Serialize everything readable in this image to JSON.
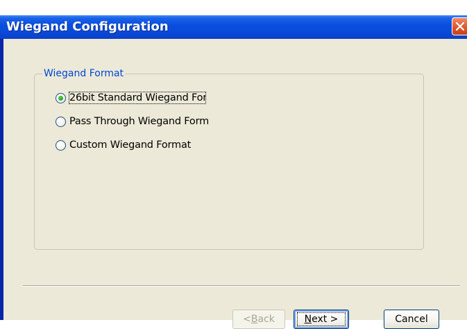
{
  "window": {
    "title": "Wiegand Configuration",
    "close_icon": "close-x-icon",
    "titlebar_color": "#0a4ad9",
    "close_color": "#e35a2f"
  },
  "group": {
    "label": "Wiegand Format",
    "label_color": "#0046d5",
    "options": [
      {
        "label": "26bit Standard Wiegand For",
        "checked": true,
        "focused": true
      },
      {
        "label": "Pass Through Wiegand Forma",
        "checked": false
      },
      {
        "label": "Custom Wiegand Format",
        "checked": false
      }
    ]
  },
  "buttons": {
    "back": {
      "prefix": "< ",
      "mnemonic": "B",
      "rest": "ack",
      "enabled": false
    },
    "next": {
      "mnemonic": "N",
      "rest": "ext >",
      "enabled": true
    },
    "cancel": {
      "label": "Cancel",
      "enabled": true
    }
  }
}
